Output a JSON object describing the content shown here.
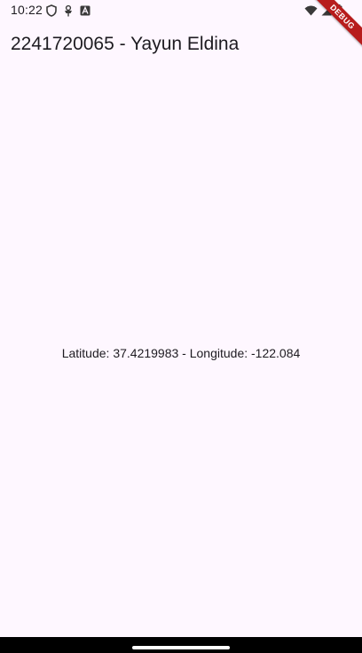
{
  "status_bar": {
    "time": "10:22",
    "left_icons": [
      "shield-icon",
      "usb-debug-icon",
      "app-notification-icon"
    ],
    "right_icons": [
      "wifi-icon",
      "signal-icon",
      "battery-icon"
    ]
  },
  "app_bar": {
    "title": "2241720065 - Yayun Eldina"
  },
  "main": {
    "location_text": "Latitude: 37.4219983 - Longitude: -122.084"
  },
  "debug_banner": {
    "label": "DEBUG",
    "color": "#b71c1c"
  },
  "colors": {
    "background": "#fef7ff",
    "text": "#1d1b20",
    "nav_bar": "#000000"
  }
}
